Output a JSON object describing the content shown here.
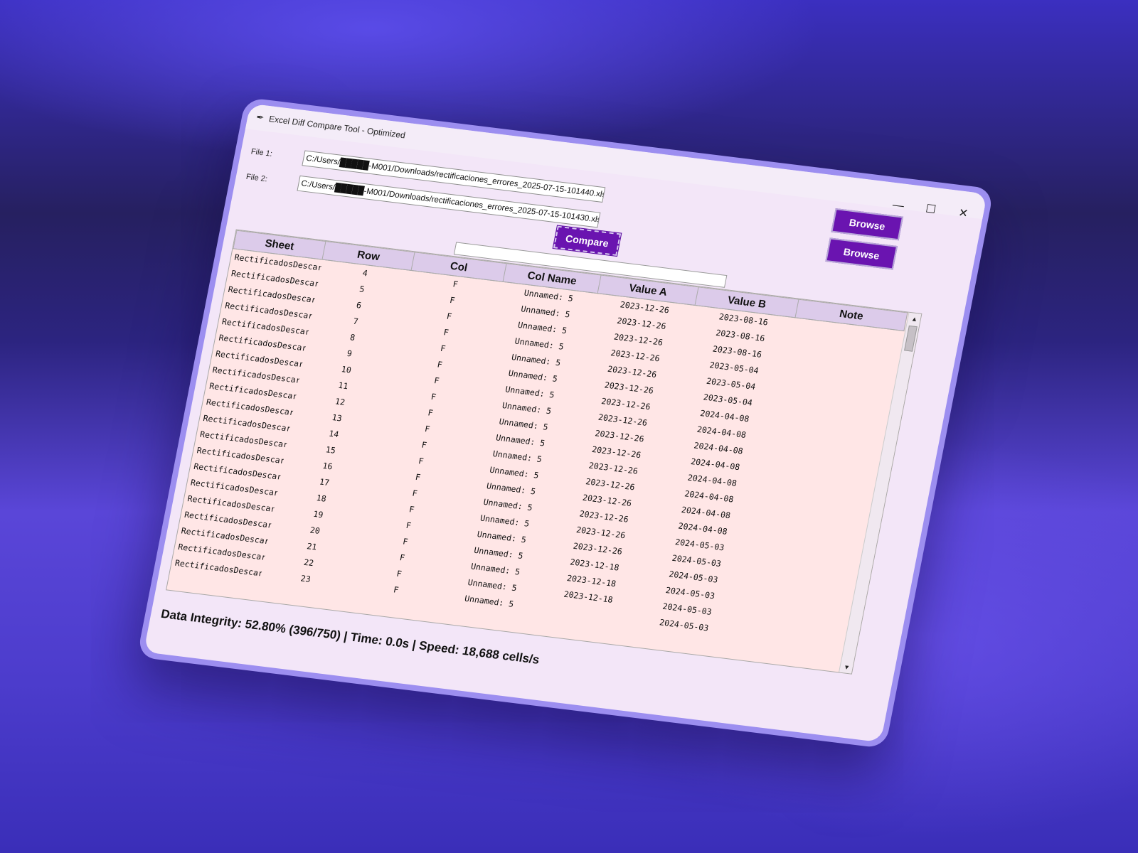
{
  "window": {
    "title": "Excel Diff Compare Tool - Optimized",
    "controls": {
      "minimize": "—",
      "maximize": "☐",
      "close": "✕"
    }
  },
  "files": {
    "file1_label": "File 1:",
    "file1_path": "C:/Users/█████-M001/Downloads/rectificaciones_errores_2025-07-15-101440.xls",
    "file2_label": "File 2:",
    "file2_path": "C:/Users/█████-M001/Downloads/rectificaciones_errores_2025-07-15-101430.xls",
    "browse_label": "Browse"
  },
  "compare_label": "Compare",
  "table": {
    "headers": [
      "Sheet",
      "Row",
      "Col",
      "Col Name",
      "Value A",
      "Value B",
      "Note"
    ],
    "rows": [
      [
        "RectificadosDescarg",
        "4",
        "F",
        "Unnamed: 5",
        "2023-12-26",
        "2023-08-16",
        ""
      ],
      [
        "RectificadosDescarg",
        "5",
        "F",
        "Unnamed: 5",
        "2023-12-26",
        "2023-08-16",
        ""
      ],
      [
        "RectificadosDescarg",
        "6",
        "F",
        "Unnamed: 5",
        "2023-12-26",
        "2023-08-16",
        ""
      ],
      [
        "RectificadosDescarg",
        "7",
        "F",
        "Unnamed: 5",
        "2023-12-26",
        "2023-05-04",
        ""
      ],
      [
        "RectificadosDescarg",
        "8",
        "F",
        "Unnamed: 5",
        "2023-12-26",
        "2023-05-04",
        ""
      ],
      [
        "RectificadosDescarg",
        "9",
        "F",
        "Unnamed: 5",
        "2023-12-26",
        "2023-05-04",
        ""
      ],
      [
        "RectificadosDescarg",
        "10",
        "F",
        "Unnamed: 5",
        "2023-12-26",
        "2024-04-08",
        ""
      ],
      [
        "RectificadosDescarg",
        "11",
        "F",
        "Unnamed: 5",
        "2023-12-26",
        "2024-04-08",
        ""
      ],
      [
        "RectificadosDescarg",
        "12",
        "F",
        "Unnamed: 5",
        "2023-12-26",
        "2024-04-08",
        ""
      ],
      [
        "RectificadosDescarg",
        "13",
        "F",
        "Unnamed: 5",
        "2023-12-26",
        "2024-04-08",
        ""
      ],
      [
        "RectificadosDescarg",
        "14",
        "F",
        "Unnamed: 5",
        "2023-12-26",
        "2024-04-08",
        ""
      ],
      [
        "RectificadosDescarg",
        "15",
        "F",
        "Unnamed: 5",
        "2023-12-26",
        "2024-04-08",
        ""
      ],
      [
        "RectificadosDescarg",
        "16",
        "F",
        "Unnamed: 5",
        "2023-12-26",
        "2024-04-08",
        ""
      ],
      [
        "RectificadosDescarg",
        "17",
        "F",
        "Unnamed: 5",
        "2023-12-26",
        "2024-04-08",
        ""
      ],
      [
        "RectificadosDescarg",
        "18",
        "F",
        "Unnamed: 5",
        "2023-12-26",
        "2024-05-03",
        ""
      ],
      [
        "RectificadosDescarg",
        "19",
        "F",
        "Unnamed: 5",
        "2023-12-26",
        "2024-05-03",
        ""
      ],
      [
        "RectificadosDescarg",
        "20",
        "F",
        "Unnamed: 5",
        "2023-12-18",
        "2024-05-03",
        ""
      ],
      [
        "RectificadosDescarg",
        "21",
        "F",
        "Unnamed: 5",
        "2023-12-18",
        "2024-05-03",
        ""
      ],
      [
        "RectificadosDescarg",
        "22",
        "F",
        "Unnamed: 5",
        "2023-12-18",
        "2024-05-03",
        ""
      ],
      [
        "RectificadosDescarg",
        "23",
        "F",
        "Unnamed: 5",
        "",
        "2024-05-03",
        ""
      ]
    ]
  },
  "scroll": {
    "up": "▲",
    "down": "▼"
  },
  "status": "Data Integrity: 52.80% (396/750) | Time: 0.0s | Speed: 18,688 cells/s",
  "colors": {
    "accent": "#6a14b0",
    "row_bg": "#ffe6e6",
    "header_bg": "#dccbea",
    "window_bg": "#f3e6f8"
  }
}
